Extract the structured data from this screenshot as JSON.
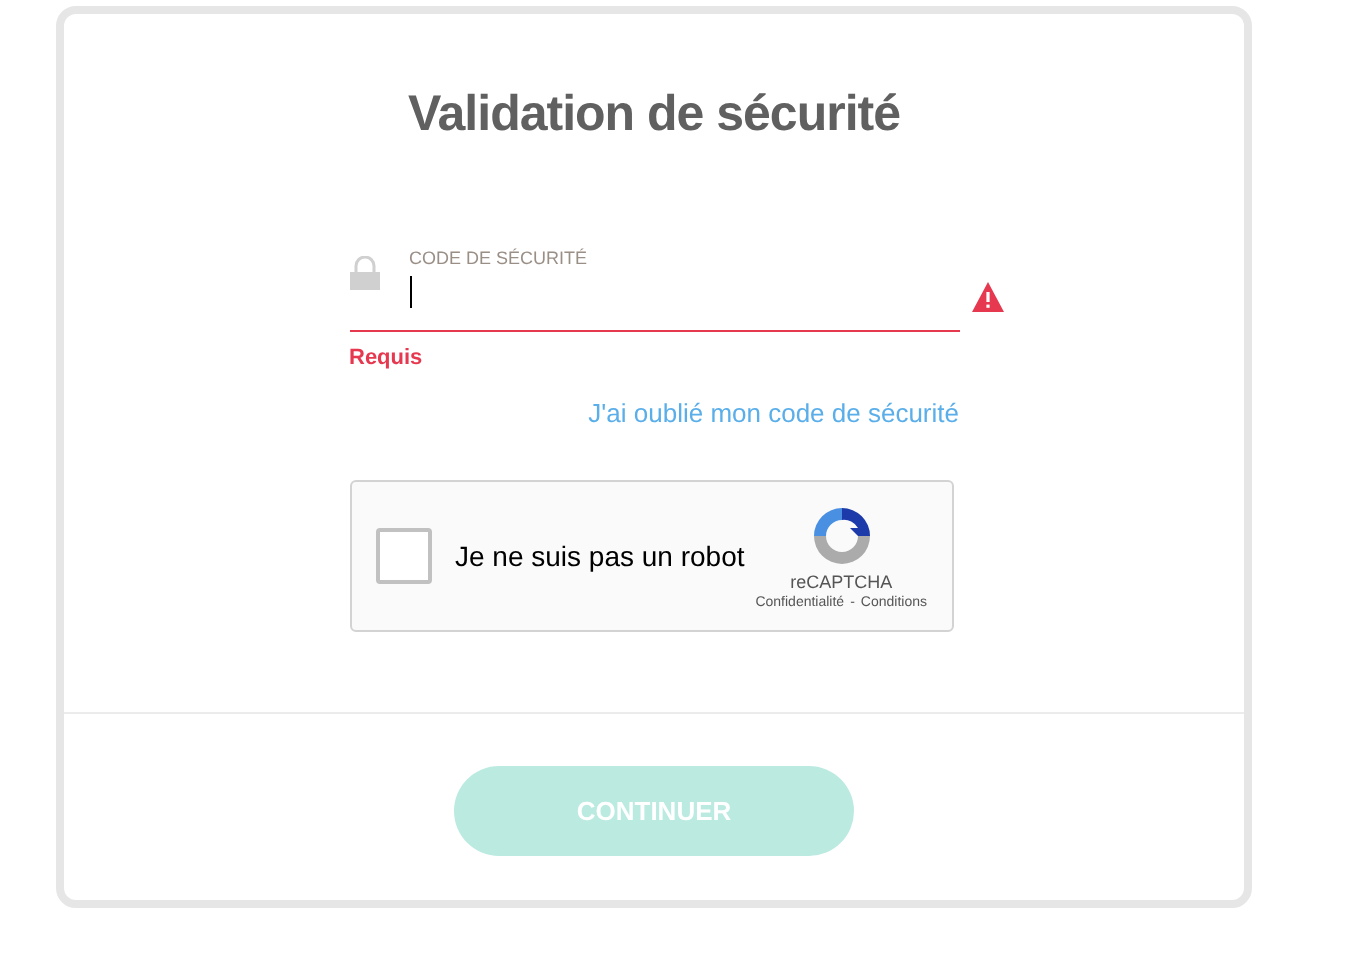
{
  "title": "Validation de sécurité",
  "field": {
    "label": "CODE DE SÉCURITÉ",
    "invalid": true,
    "error": "Requis"
  },
  "forgot_link": "J'ai oublié mon code de sécurité",
  "captcha": {
    "label": "Je ne suis pas un robot",
    "checked": false,
    "brand": "reCAPTCHA",
    "privacy": "Confidentialité",
    "separator": "-",
    "terms": "Conditions"
  },
  "button": {
    "label": "CONTINUER",
    "disabled": true
  }
}
